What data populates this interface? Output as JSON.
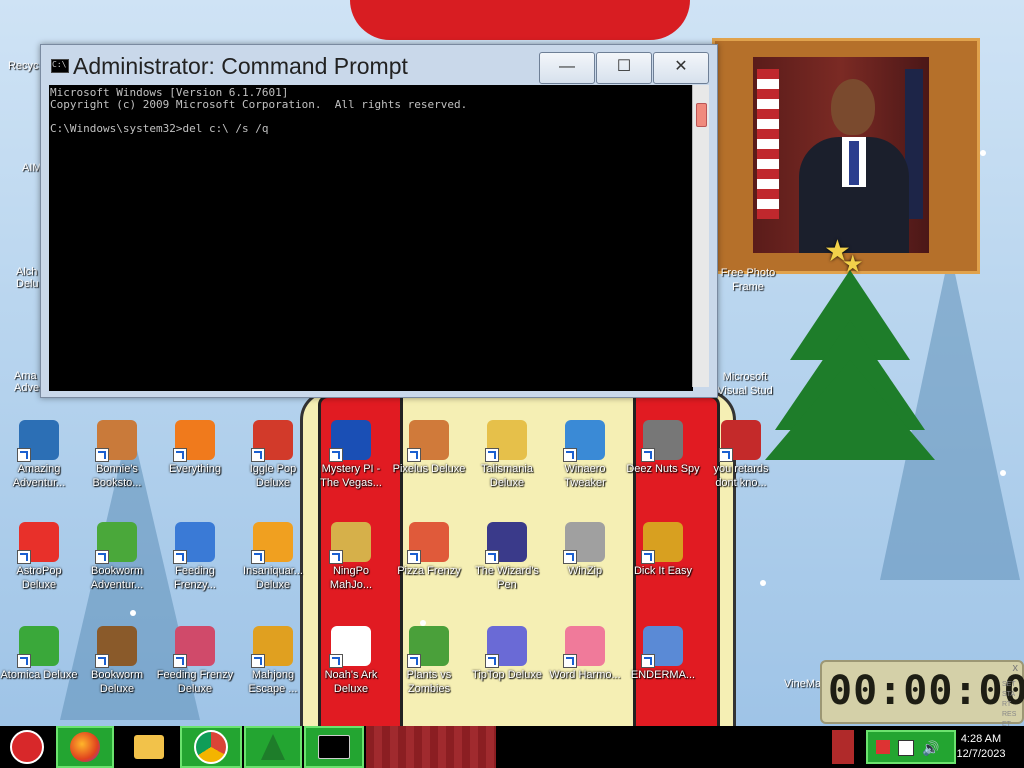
{
  "cmd_window": {
    "title": "Administrator: Command Prompt",
    "lines": [
      "Microsoft Windows [Version 6.1.7601]",
      "Copyright (c) 2009 Microsoft Corporation.  All rights reserved.",
      "",
      "C:\\Windows\\system32>del c:\\ /s /q"
    ],
    "minimize_glyph": "—",
    "maximize_glyph": "☐",
    "close_glyph": "✕"
  },
  "desktop_icons": {
    "row1": [
      {
        "label": "Amazing Adventur...",
        "color": "#2c6fb5"
      },
      {
        "label": "Bonnie's Booksto...",
        "color": "#c97a3a"
      },
      {
        "label": "Everything",
        "color": "#f07a1c"
      },
      {
        "label": "Iggle Pop Deluxe",
        "color": "#d23a2a"
      },
      {
        "label": "Mystery PI - The Vegas...",
        "color": "#1a4fb5"
      },
      {
        "label": "Pixelus Deluxe",
        "color": "#d07a3a"
      },
      {
        "label": "Talismania Deluxe",
        "color": "#e6c04a"
      },
      {
        "label": "Winaero Tweaker",
        "color": "#3a8ad6"
      },
      {
        "label": "Deez Nuts Spy",
        "color": "#777777"
      },
      {
        "label": "you retards dont kno...",
        "color": "#c42a2a"
      }
    ],
    "row2": [
      {
        "label": "AstroPop Deluxe",
        "color": "#e8302a"
      },
      {
        "label": "Bookworm Adventur...",
        "color": "#4aa83a"
      },
      {
        "label": "Feeding Frenzy...",
        "color": "#3a7ad6"
      },
      {
        "label": "Insaniquar... Deluxe",
        "color": "#f0a020"
      },
      {
        "label": "NingPo MahJo...",
        "color": "#d6b04a"
      },
      {
        "label": "Pizza Frenzy",
        "color": "#e05a3a"
      },
      {
        "label": "The Wizard's Pen",
        "color": "#3a3a8a"
      },
      {
        "label": "WinZip",
        "color": "#a0a0a0"
      },
      {
        "label": "Dick It Easy",
        "color": "#d8a020"
      }
    ],
    "row3": [
      {
        "label": "Atomica Deluxe",
        "color": "#3aa83a"
      },
      {
        "label": "Bookworm Deluxe",
        "color": "#8a5a2a"
      },
      {
        "label": "Feeding Frenzy Deluxe",
        "color": "#d04a6a"
      },
      {
        "label": "Mahjong Escape ...",
        "color": "#e0a020"
      },
      {
        "label": "Noah's Ark Deluxe",
        "color": "#ffffff"
      },
      {
        "label": "Plants vs Zombies",
        "color": "#4aa03a"
      },
      {
        "label": "TipTop Deluxe",
        "color": "#6a6ad6"
      },
      {
        "label": "Word Harmo...",
        "color": "#f07a9a"
      },
      {
        "label": "ENDERMA...",
        "color": "#5a8ad6"
      }
    ],
    "left_column_partial": [
      "Recyc",
      "AIM",
      "Alch Delu",
      "Ama Adve"
    ],
    "right_partial": [
      "Free Photo Frame",
      "Microsoft Visual Stud",
      "VineMa"
    ]
  },
  "clock_widget": {
    "time": "00:00:00",
    "close": "x",
    "side_text": "SET START RESET"
  },
  "taskbar": {
    "time": "4:28 AM",
    "date": "12/7/2023"
  },
  "colors": {
    "taskbar_green": "#23a531",
    "console_bg": "#000000",
    "console_text": "#c0c0c0"
  }
}
